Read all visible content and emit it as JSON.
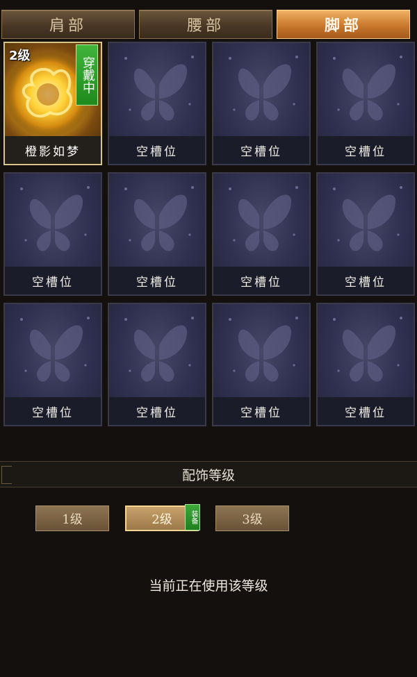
{
  "tabs": [
    {
      "label": "肩部",
      "active": false
    },
    {
      "label": "腰部",
      "active": false
    },
    {
      "label": "脚部",
      "active": true
    }
  ],
  "slots": [
    {
      "label": "橙影如梦",
      "level": "2级",
      "status": "穿戴中",
      "equipped": true,
      "icon": "golden-fire-orb-icon"
    },
    {
      "label": "空槽位",
      "icon": "butterfly-icon"
    },
    {
      "label": "空槽位",
      "icon": "butterfly-icon"
    },
    {
      "label": "空槽位",
      "icon": "butterfly-icon"
    },
    {
      "label": "空槽位",
      "icon": "butterfly-icon"
    },
    {
      "label": "空槽位",
      "icon": "butterfly-icon"
    },
    {
      "label": "空槽位",
      "icon": "butterfly-icon"
    },
    {
      "label": "空槽位",
      "icon": "butterfly-icon"
    },
    {
      "label": "空槽位",
      "icon": "butterfly-icon"
    },
    {
      "label": "空槽位",
      "icon": "butterfly-icon"
    },
    {
      "label": "空槽位",
      "icon": "butterfly-icon"
    },
    {
      "label": "空槽位",
      "icon": "butterfly-icon"
    }
  ],
  "section": {
    "title": "配饰等级"
  },
  "levels": [
    {
      "label": "1级",
      "active": false
    },
    {
      "label": "2级",
      "active": true,
      "badge": "装备"
    },
    {
      "label": "3级",
      "active": false
    }
  ],
  "status_text": "当前正在使用该等级",
  "colors": {
    "accent": "#c9782c",
    "equipped_green": "#2fa02a",
    "slot_bg": "#2f3050"
  }
}
